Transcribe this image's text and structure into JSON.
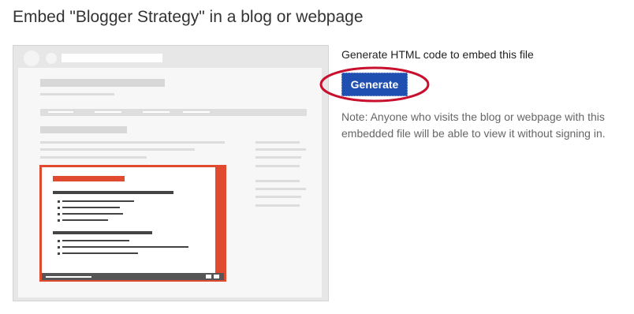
{
  "dialog": {
    "title": "Embed \"Blogger Strategy\" in a blog or webpage"
  },
  "embed": {
    "generate_prompt": "Generate HTML code to embed this file",
    "generate_button": "Generate",
    "note": "Note: Anyone who visits the blog or webpage with this embedded file will be able to view it without signing in."
  },
  "colors": {
    "accent": "#1f4fb0",
    "annotation": "#c8102e",
    "illustration_frame": "#e7e7e7",
    "illustration_accent": "#e04b2f"
  },
  "icons": {
    "preview": "embedded-document-illustration"
  }
}
